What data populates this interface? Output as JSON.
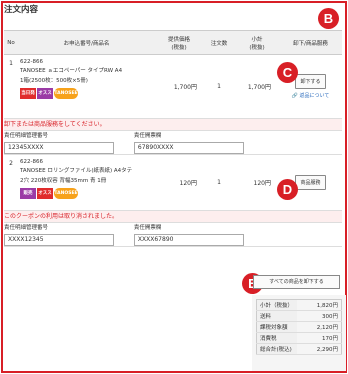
{
  "section_title": "注文内容",
  "callouts": {
    "b": "B",
    "c": "C",
    "d": "D",
    "e": "E"
  },
  "table": {
    "headers": {
      "no": "No",
      "product": "お申込番号/商品名",
      "price": "提供価格\n(税抜)",
      "qty": "注文数",
      "subtotal": "小計\n(税抜)",
      "action": "卸下/商品服務"
    },
    "items": [
      {
        "no": "1",
        "code": "622-866",
        "name_line1": "TANOSEE ａエコペーパー タイプRW A4",
        "name_line2": "1箱(2500枚：500枚×5冊)",
        "badges": [
          {
            "text": "当日発送",
            "color": "red"
          },
          {
            "text": "オススメ",
            "color": "purple"
          },
          {
            "text": "TANOSEE",
            "color": "orange"
          }
        ],
        "price": "1,700円",
        "qty": "1",
        "subtotal": "1,700円",
        "action_button": "卸下する",
        "action_link": "返品について",
        "warning": "卸下または商品服務をしてください。",
        "field1_label": "責任明細管理番号",
        "field1_value": "12345XXXX",
        "field2_label": "責任開票欄",
        "field2_value": "67890XXXX"
      },
      {
        "no": "2",
        "code": "622-866",
        "name_line1": "TANOSEE ロリングファイル(紙表紙) A4タテ",
        "name_line2": "2穴 220枚収容 背幅35mm 青 1冊",
        "badges": [
          {
            "text": "販売",
            "color": "purple"
          },
          {
            "text": "オススメ",
            "color": "red"
          },
          {
            "text": "TANOSEE",
            "color": "orange"
          }
        ],
        "price": "120円",
        "qty": "1",
        "subtotal": "120円",
        "action_button": "商品服務",
        "action_link": "",
        "warning": "このクーポンの利用は取り消されました。",
        "field1_label": "責任明細管理番号",
        "field1_value": "XXXX12345",
        "field2_label": "責任開票欄",
        "field2_value": "XXXX67890"
      }
    ]
  },
  "clear_all_button": "すべての商品を卸下する",
  "totals": [
    {
      "label": "小計（税抜）",
      "value": "1,820円"
    },
    {
      "label": "送料",
      "value": "300円"
    },
    {
      "label": "課税対象額",
      "value": "2,120円"
    },
    {
      "label": "消費税",
      "value": "170円"
    },
    {
      "label": "総合計(税込)",
      "value": "2,290円"
    }
  ],
  "colors": {
    "accent": "#d81f26",
    "link": "#2a6bbd"
  }
}
